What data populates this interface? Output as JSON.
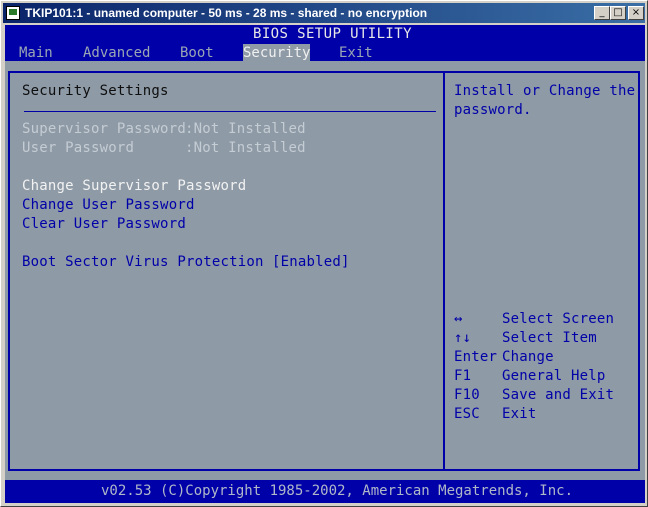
{
  "window": {
    "title": "TKIP101:1 - unamed computer - 50 ms - 28 ms - shared - no encryption",
    "minimize": "_",
    "restore": "□",
    "close": "×"
  },
  "bios": {
    "title": "BIOS SETUP UTILITY",
    "menu": [
      "Main",
      "Advanced",
      "Boot",
      "Security",
      "Exit"
    ],
    "active_menu": "Security",
    "section_title": "Security Settings",
    "status": [
      {
        "label": "Supervisor Password",
        "value": ":Not Installed"
      },
      {
        "label": "User Password",
        "value": ":Not Installed"
      }
    ],
    "actions": [
      "Change Supervisor Password",
      "Change User Password",
      "Clear User Password"
    ],
    "option": {
      "label": "Boot Sector Virus Protection",
      "value": "[Enabled]"
    },
    "help_line1": "Install or Change the",
    "help_line2": "password.",
    "keys": [
      {
        "key": "↔",
        "desc": "Select Screen"
      },
      {
        "key": "↑↓",
        "desc": "Select Item"
      },
      {
        "key": "Enter",
        "desc": "Change"
      },
      {
        "key": "F1",
        "desc": "General Help"
      },
      {
        "key": "F10",
        "desc": "Save and Exit"
      },
      {
        "key": "ESC",
        "desc": "Exit"
      }
    ],
    "footer": "v02.53 (C)Copyright 1985-2002, American Megatrends, Inc."
  }
}
